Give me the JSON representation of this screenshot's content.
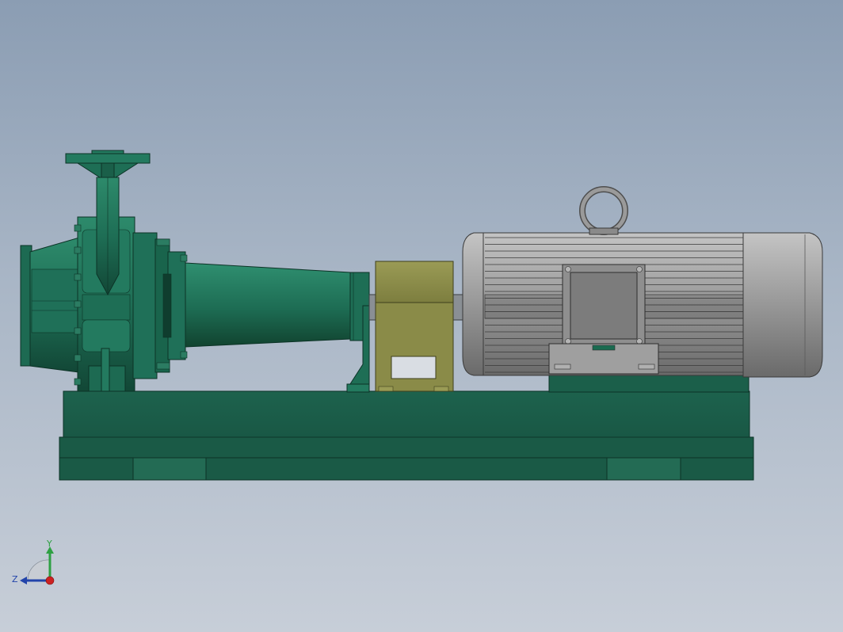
{
  "viewport": {
    "background_top": "#8b9db3",
    "background_bottom": "#c7ced8"
  },
  "model": {
    "colors": {
      "pump_green": "#1e6e55",
      "pump_green_dark": "#134c3a",
      "pump_green_light": "#2f8a6c",
      "base_green": "#1a5c48",
      "bracket_olive": "#8c8d4a",
      "motor_gray": "#9a9a9a",
      "motor_gray_dark": "#6e6e6e",
      "motor_gray_light": "#bdbdbd"
    }
  },
  "triad": {
    "y_label": "Y",
    "z_label": "Z",
    "y_color": "#2ea043",
    "z_color": "#2244aa",
    "x_color": "#cc2222"
  }
}
